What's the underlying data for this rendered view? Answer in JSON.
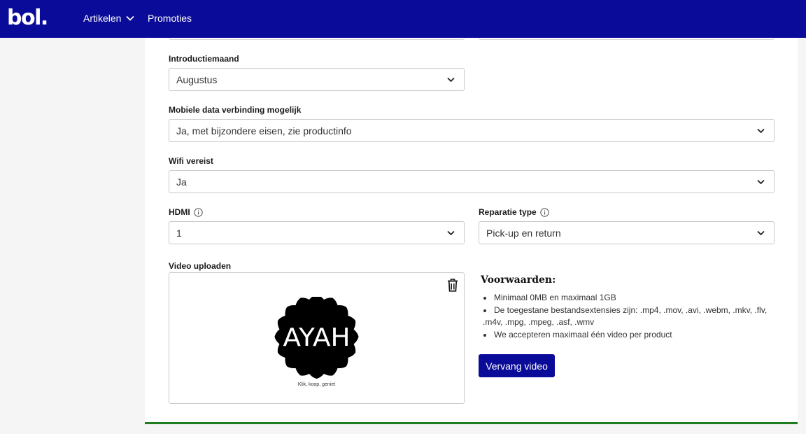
{
  "header": {
    "logo": "bol.",
    "nav": [
      {
        "label": "Artikelen",
        "has_dropdown": true
      },
      {
        "label": "Promoties",
        "has_dropdown": false
      }
    ],
    "background_color": "#0b0b99"
  },
  "form": {
    "introductiemaand": {
      "label": "Introductiemaand",
      "value": "Augustus"
    },
    "mobiele_data": {
      "label": "Mobiele data verbinding mogelijk",
      "value": "Ja, met bijzondere eisen, zie productinfo"
    },
    "wifi": {
      "label": "Wifi vereist",
      "value": "Ja"
    },
    "hdmi": {
      "label": "HDMI",
      "value": "1",
      "info_icon": "info-icon"
    },
    "reparatie": {
      "label": "Reparatie type",
      "value": "Pick-up en return",
      "info_icon": "info-icon"
    }
  },
  "video": {
    "label": "Video uploaden",
    "thumbnail_text": "AYAH",
    "thumbnail_caption": "Klik, koop, geniet",
    "delete_icon": "trash-icon"
  },
  "terms": {
    "title": "Voorwaarden:",
    "items": [
      "Minimaal 0MB en maximaal 1GB",
      "De toegestane bestandsextensies zijn: .mp4, .mov, .avi, .webm, .mkv, .flv, .m4v, .mpg, .mpeg, .asf, .wmv",
      "We accepteren maximaal één video per product"
    ]
  },
  "actions": {
    "replace_video": "Vervang video"
  },
  "colors": {
    "primary": "#0b0b99",
    "success_line": "#1e7d1e"
  }
}
